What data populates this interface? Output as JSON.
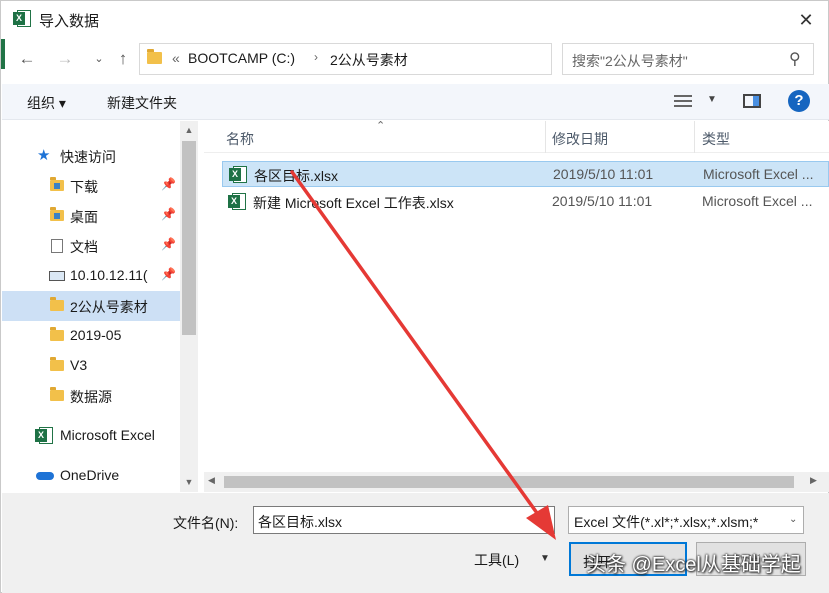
{
  "window": {
    "title": "导入数据",
    "close": "✕"
  },
  "address": {
    "chevron": "«",
    "drive": "BOOTCAMP (C:)",
    "separator": "›",
    "folder": "2公从号素材",
    "search_placeholder": "搜索\"2公从号素材\""
  },
  "toolbar": {
    "organize": "组织 ▾",
    "new_folder": "新建文件夹"
  },
  "nav": {
    "quick_access": "快速访问",
    "items": [
      {
        "label": "下载",
        "pinned": true
      },
      {
        "label": "桌面",
        "pinned": true
      },
      {
        "label": "文档",
        "pinned": true
      },
      {
        "label": "10.10.12.11(",
        "pinned": true
      },
      {
        "label": "2公从号素材",
        "selected": true
      },
      {
        "label": "2019-05"
      },
      {
        "label": "V3"
      },
      {
        "label": "数据源"
      }
    ],
    "excel": "Microsoft Excel",
    "onedrive": "OneDrive"
  },
  "columns": {
    "name": "名称",
    "modified": "修改日期",
    "type": "类型"
  },
  "files": [
    {
      "name": "各区目标.xlsx",
      "modified": "2019/5/10 11:01",
      "type": "Microsoft Excel ..."
    },
    {
      "name": "新建 Microsoft Excel 工作表.xlsx",
      "modified": "2019/5/10 11:01",
      "type": "Microsoft Excel ..."
    }
  ],
  "bottom": {
    "filename_label": "文件名(N):",
    "filename_value": "各区目标.xlsx",
    "filter": "Excel 文件(*.xl*;*.xlsx;*.xlsm;*",
    "tools": "工具(L)",
    "open": "打开",
    "cancel": "取消"
  },
  "watermark": "头条 @Excel从基础学起",
  "colors": {
    "accent": "#0078d7",
    "selection": "#cce4f7",
    "arrow": "#e53935",
    "excel_green": "#217346"
  }
}
